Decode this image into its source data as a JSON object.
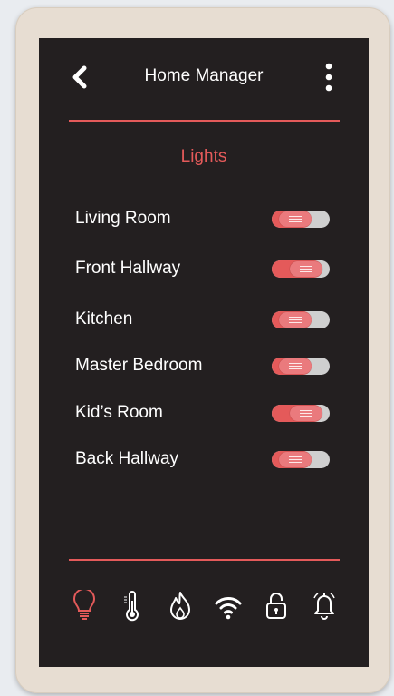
{
  "header": {
    "title": "Home Manager",
    "back_icon": "chevron-left-icon",
    "menu_icon": "more-vertical-icon"
  },
  "section": {
    "title": "Lights"
  },
  "lights": [
    {
      "label": "Living Room",
      "on": 0.3
    },
    {
      "label": "Front Hallway",
      "on": 0.7
    },
    {
      "label": "Kitchen",
      "on": 0.3
    },
    {
      "label": "Master Bedroom",
      "on": 0.3
    },
    {
      "label": "Kid’s Room",
      "on": 0.7
    },
    {
      "label": "Back Hallway",
      "on": 0.3
    }
  ],
  "tabs": [
    {
      "icon": "lightbulb-icon",
      "active": true
    },
    {
      "icon": "thermometer-icon",
      "active": false
    },
    {
      "icon": "flame-icon",
      "active": false
    },
    {
      "icon": "wifi-icon",
      "active": false
    },
    {
      "icon": "padlock-icon",
      "active": false
    },
    {
      "icon": "bell-icon",
      "active": false
    }
  ],
  "colors": {
    "accent": "#e45a5a",
    "screen_bg": "#231f20",
    "text": "#ffffff",
    "device_frame": "#e7ddd2"
  }
}
